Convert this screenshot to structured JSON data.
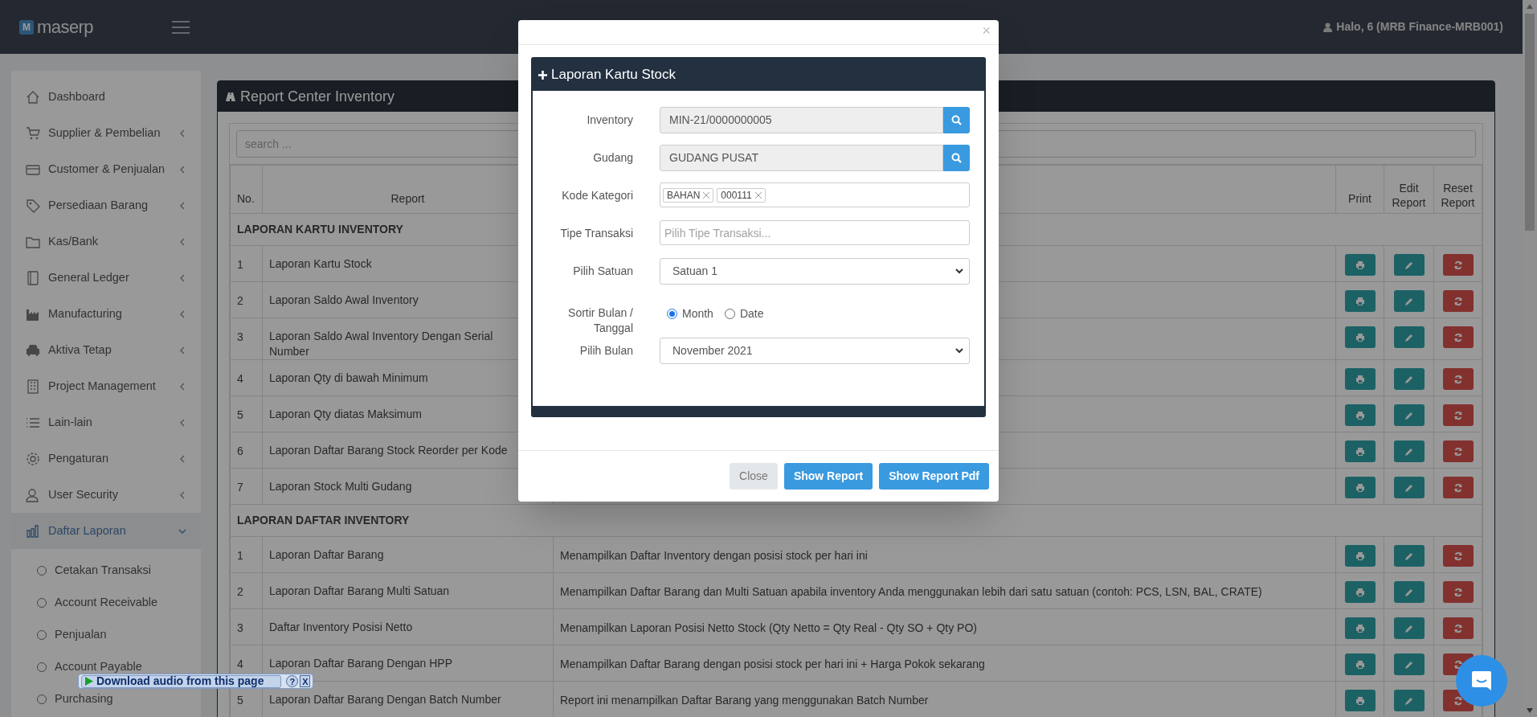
{
  "brand": {
    "logo_letter": "M",
    "name": "maserp"
  },
  "user": "Halo, 6 (MRB Finance-MRB001)",
  "sidebar": {
    "items": [
      {
        "label": "Dashboard",
        "kind": "link",
        "expanded": false
      },
      {
        "label": "Supplier & Pembelian",
        "kind": "menu",
        "expanded": false
      },
      {
        "label": "Customer & Penjualan",
        "kind": "menu",
        "expanded": false
      },
      {
        "label": "Persediaan Barang",
        "kind": "menu",
        "expanded": false
      },
      {
        "label": "Kas/Bank",
        "kind": "menu",
        "expanded": false
      },
      {
        "label": "General Ledger",
        "kind": "menu",
        "expanded": false
      },
      {
        "label": "Manufacturing",
        "kind": "menu",
        "expanded": false
      },
      {
        "label": "Aktiva Tetap",
        "kind": "menu",
        "expanded": false
      },
      {
        "label": "Project Management",
        "kind": "menu",
        "expanded": false
      },
      {
        "label": "Lain-lain",
        "kind": "menu",
        "expanded": false
      },
      {
        "label": "Pengaturan",
        "kind": "menu",
        "expanded": false
      },
      {
        "label": "User Security",
        "kind": "menu",
        "expanded": false
      },
      {
        "label": "Daftar Laporan",
        "kind": "menu",
        "expanded": true,
        "children": [
          {
            "label": "Cetakan Transaksi"
          },
          {
            "label": "Account Receivable"
          },
          {
            "label": "Penjualan"
          },
          {
            "label": "Account Payable"
          },
          {
            "label": "Purchasing"
          }
        ]
      }
    ]
  },
  "panel": {
    "title": "Report Center Inventory",
    "search": {
      "placeholder": "search ..."
    },
    "table": {
      "columns": {
        "no": "No.",
        "report": "Report",
        "print": "Print",
        "edit": "Edit Report",
        "reset": "Reset Report"
      },
      "sections": [
        {
          "title": "LAPORAN KARTU INVENTORY",
          "rows": [
            {
              "no": "1",
              "report": "Laporan Kartu Stock"
            },
            {
              "no": "2",
              "report": "Laporan Saldo Awal Inventory"
            },
            {
              "no": "3",
              "report": "Laporan Saldo Awal Inventory Dengan Serial Number"
            },
            {
              "no": "4",
              "report": "Laporan Qty di bawah Minimum"
            },
            {
              "no": "5",
              "report": "Laporan Qty diatas Maksimum"
            },
            {
              "no": "6",
              "report": "Laporan Daftar Barang Stock Reorder per Kode"
            },
            {
              "no": "7",
              "report": "Laporan Stock Multi Gudang"
            }
          ]
        },
        {
          "title": "LAPORAN DAFTAR INVENTORY",
          "rows": [
            {
              "no": "1",
              "report": "Laporan Daftar Barang",
              "description": "Menampilkan Daftar Inventory dengan posisi stock per hari ini"
            },
            {
              "no": "2",
              "report": "Laporan Daftar Barang Multi Satuan",
              "description": "Menampilkan Daftar Barang dan Multi Satuan apabila inventory Anda menggunakan lebih dari satu satuan (contoh: PCS, LSN, BAL, CRATE)"
            },
            {
              "no": "3",
              "report": "Daftar Inventory Posisi Netto",
              "description": "Menampilkan Laporan Posisi Netto Stock (Qty Netto = Qty Real - Qty SO + Qty PO)"
            },
            {
              "no": "4",
              "report": "Laporan Daftar Barang Dengan HPP",
              "description": "Menampilkan Daftar Barang dengan posisi stock per hari ini + Harga Pokok sekarang"
            },
            {
              "no": "5",
              "report": "Laporan Daftar Barang Dengan Batch Number",
              "description": "Report ini menampilkan Daftar Barang yang menggunakan Batch Number"
            }
          ]
        }
      ]
    }
  },
  "modal": {
    "close": "×",
    "title": "Laporan Kartu Stock",
    "fields": [
      {
        "kind": "lookup",
        "label": "Inventory",
        "value": "MIN-21/0000000005"
      },
      {
        "kind": "lookup",
        "label": "Gudang",
        "value": "GUDANG PUSAT"
      },
      {
        "kind": "tags",
        "label": "Kode Kategori",
        "tags": [
          "BAHAN",
          "000111"
        ]
      },
      {
        "kind": "input",
        "label": "Tipe Transaksi",
        "placeholder": "Pilih Tipe Transaksi..."
      },
      {
        "kind": "select",
        "label": "Pilih Satuan",
        "value": "Satuan 1"
      },
      {
        "kind": "radio",
        "label": "Sortir Bulan / Tanggal",
        "options": [
          {
            "label": "Month",
            "selected": true
          },
          {
            "label": "Date",
            "selected": false
          }
        ]
      },
      {
        "kind": "select",
        "label": "Pilih Bulan",
        "value": "November 2021"
      }
    ],
    "buttons": [
      {
        "label": "Close",
        "kind": "secondary"
      },
      {
        "label": "Show Report",
        "kind": "primary"
      },
      {
        "label": "Show Report Pdf",
        "kind": "primary"
      }
    ]
  },
  "download_bar": {
    "label": "Download audio from this page",
    "help": "?",
    "close": "X"
  }
}
